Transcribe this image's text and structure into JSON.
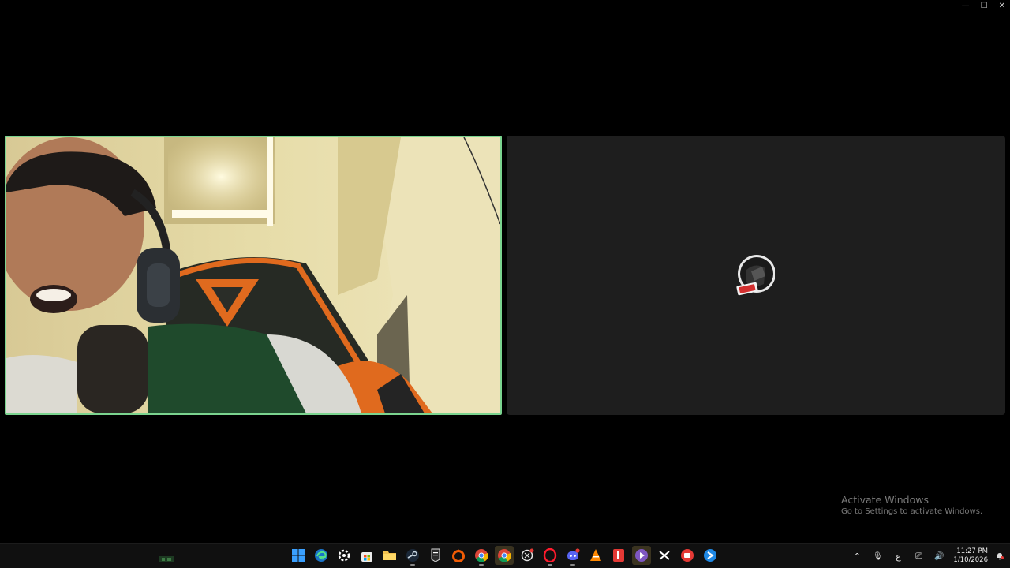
{
  "window": {
    "minimize": "—",
    "maximize": "☐",
    "close": "✕"
  },
  "tiles": {
    "left": {
      "kind": "camera-video",
      "border_color": "#7bd48f"
    },
    "right": {
      "kind": "avatar",
      "background": "#1e1e1e"
    }
  },
  "watermark": {
    "title": "Activate Windows",
    "subtitle": "Go to Settings to activate Windows."
  },
  "taskbar": {
    "apps": [
      {
        "name": "start-icon",
        "color": "#3aa0ff"
      },
      {
        "name": "edge-icon",
        "color": "#2b9fd6"
      },
      {
        "name": "steelseries-icon",
        "color": "#ffffff"
      },
      {
        "name": "store-icon",
        "color": "#5ab0ff"
      },
      {
        "name": "file-explorer-icon",
        "color": "#f2c14e"
      },
      {
        "name": "steam-icon",
        "color": "#c7d5e0"
      },
      {
        "name": "epic-games-icon",
        "color": "#ffffff"
      },
      {
        "name": "origin-icon",
        "color": "#f25c05"
      },
      {
        "name": "chrome-icon",
        "color": "#4caf50"
      },
      {
        "name": "chrome-icon",
        "color": "#4caf50"
      },
      {
        "name": "chatgpt-icon",
        "color": "#ffffff"
      },
      {
        "name": "opera-icon",
        "color": "#ff1b2d"
      },
      {
        "name": "discord-icon",
        "color": "#5865f2"
      },
      {
        "name": "vlc-icon",
        "color": "#ff8800"
      },
      {
        "name": "app-red-icon",
        "color": "#e53935"
      },
      {
        "name": "media-player-icon",
        "color": "#7e57c2"
      },
      {
        "name": "capcut-icon",
        "color": "#ffffff"
      },
      {
        "name": "app-red-circle-icon",
        "color": "#e53935"
      },
      {
        "name": "app-blue-icon",
        "color": "#1e88e5"
      }
    ],
    "tray": {
      "chevron": "^",
      "mic": "🎙",
      "lang": "ع",
      "network": "⎚",
      "volume": "🔊",
      "time": "11:27 PM",
      "date": "1/10/2026"
    }
  }
}
